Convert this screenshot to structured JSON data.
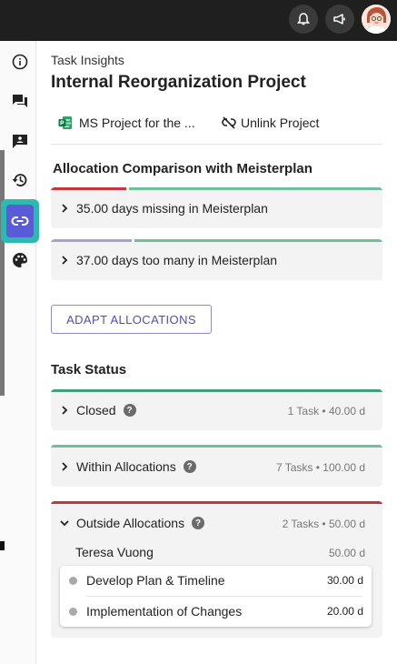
{
  "colors": {
    "green": "#6fbf9b",
    "red": "#c0393f",
    "lavender": "#a99fd0",
    "dark_green": "#3f9f7e",
    "accent": "#5a5bd6",
    "teal": "#2bb9b0"
  },
  "topbar": {
    "icons": [
      "bell-icon",
      "megaphone-icon",
      "user-avatar"
    ]
  },
  "rail": {
    "icons": [
      "info-icon",
      "chat-icon",
      "contact-card-icon",
      "history-icon",
      "link-icon",
      "palette-icon"
    ]
  },
  "header": {
    "subtitle": "Task Insights",
    "title": "Internal Reorganization Project"
  },
  "links": {
    "ms_project_label": "MS Project for the ...",
    "unlink_label": "Unlink Project"
  },
  "allocation": {
    "title": "Allocation Comparison with Meisterplan",
    "items": [
      {
        "label": "35.00 days missing in Meisterplan"
      },
      {
        "label": "37.00 days too many in Meisterplan"
      }
    ],
    "adapt_button": "ADAPT ALLOCATIONS"
  },
  "task_status": {
    "title": "Task Status",
    "groups": [
      {
        "label": "Closed",
        "help": "?",
        "meta": "1 Task • 40.00 d"
      },
      {
        "label": "Within Allocations",
        "help": "?",
        "meta": "7 Tasks • 100.00 d"
      },
      {
        "label": "Outside Allocations",
        "help": "?",
        "meta": "2 Tasks • 50.00 d",
        "person": {
          "name": "Teresa Vuong",
          "value": "50.00 d"
        },
        "tasks": [
          {
            "name": "Develop Plan & Timeline",
            "value": "30.00 d"
          },
          {
            "name": "Implementation of Changes",
            "value": "20.00 d"
          }
        ]
      }
    ]
  }
}
